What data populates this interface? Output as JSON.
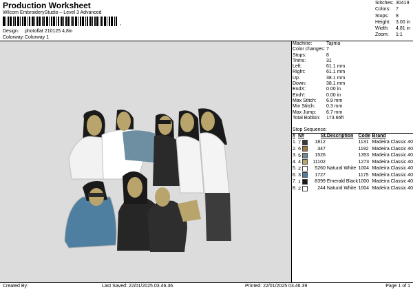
{
  "header": {
    "title": "Production Worksheet",
    "subtitle": "Wilcom EmbroideryStudio – Level 3 Advanced",
    "barcode_mark": ",",
    "design_label": "Design:",
    "design_value": "photoflat 210125 4,8in",
    "colorway_label": "Colorway:",
    "colorway_value": "Colorway 1"
  },
  "top_info": [
    {
      "key": "Stitches:",
      "value": "30419"
    },
    {
      "key": "Colors:",
      "value": "7"
    },
    {
      "key": "Stops:",
      "value": "8"
    },
    {
      "key": "Height:",
      "value": "3.00 in"
    },
    {
      "key": "Width:",
      "value": "4.81 in"
    },
    {
      "key": "Zoom:",
      "value": "1:1"
    }
  ],
  "machine_info": [
    {
      "key": "Machine:",
      "value": "Tajima"
    },
    {
      "key": "Color changes:",
      "value": "7"
    },
    {
      "key": "Stops:",
      "value": "8"
    },
    {
      "key": "Trims:",
      "value": "31"
    },
    {
      "key": "Left:",
      "value": "61.1 mm"
    },
    {
      "key": "Right:",
      "value": "61.1 mm"
    },
    {
      "key": "Up:",
      "value": "38.1 mm"
    },
    {
      "key": "Down:",
      "value": "38.1 mm"
    },
    {
      "key": "EndX:",
      "value": "0.00 in"
    },
    {
      "key": "EndY:",
      "value": "0.00 in"
    },
    {
      "key": "Max Stitch:",
      "value": "6.9 mm"
    },
    {
      "key": "Min Stitch:",
      "value": "0.3 mm"
    },
    {
      "key": "Max Jump:",
      "value": "6.7 mm"
    },
    {
      "key": "Total Bobbin:",
      "value": "173.66ft"
    }
  ],
  "stop_sequence": {
    "title": "Stop Sequence:",
    "columns": [
      "#",
      "N#",
      "St.",
      "Description",
      "Code",
      "Brand"
    ],
    "rows": [
      {
        "num": "1.",
        "n": "7",
        "color": "#3a3a3a",
        "st": "1812",
        "desc": "",
        "code": "1131",
        "brand": "Madeira Classic 40"
      },
      {
        "num": "2.",
        "n": "6",
        "color": "#a07a3c",
        "st": "347",
        "desc": "",
        "code": "1192",
        "brand": "Madeira Classic 40"
      },
      {
        "num": "3.",
        "n": "5",
        "color": "#6e8b96",
        "st": "1526",
        "desc": "",
        "code": "1353",
        "brand": "Madeira Classic 40"
      },
      {
        "num": "4.",
        "n": "4",
        "color": "#b9a46c",
        "st": "11102",
        "desc": "",
        "code": "1273",
        "brand": "Madeira Classic 40"
      },
      {
        "num": "5.",
        "n": "2",
        "color": "#ffffff",
        "st": "5260",
        "desc": "Natural White",
        "code": "1004",
        "brand": "Madeira Classic 40"
      },
      {
        "num": "6.",
        "n": "3",
        "color": "#4e7fa0",
        "st": "1727",
        "desc": "",
        "code": "1175",
        "brand": "Madeira Classic 40"
      },
      {
        "num": "7.",
        "n": "1",
        "color": "#1a1a1a",
        "st": "8399",
        "desc": "Emerald Black",
        "code": "1000",
        "brand": "Madeira Classic 40"
      },
      {
        "num": "8.",
        "n": "2",
        "color": "#ffffff",
        "st": "244",
        "desc": "Natural White",
        "code": "1004",
        "brand": "Madeira Classic 40"
      }
    ]
  },
  "footer": {
    "created": "Created By:",
    "saved": "Last Saved: 22/01/2025 03.46.36",
    "printed": "Printed: 22/01/2025 03.46.39",
    "page": "Page 1 of 1"
  }
}
